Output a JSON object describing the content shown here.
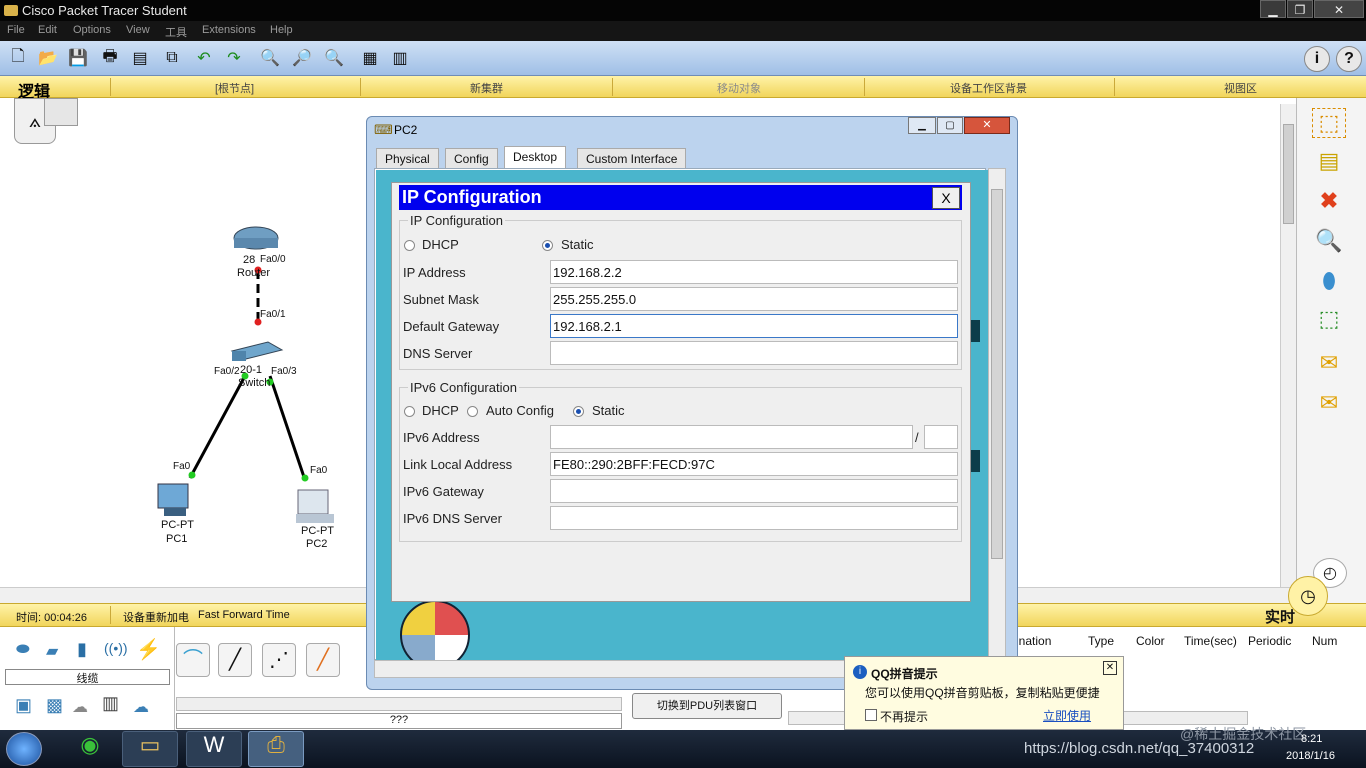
{
  "app": {
    "title": "Cisco Packet Tracer Student"
  },
  "menu": [
    "File",
    "Edit",
    "Options",
    "View",
    "工具",
    "Extensions",
    "Help"
  ],
  "nav": {
    "logic_tab": "逻辑",
    "segments": [
      "[根节点]",
      "新集群",
      "移动对象",
      "设备工作区背景",
      "视图区"
    ]
  },
  "topology": {
    "router": {
      "model": "28",
      "name": "Router",
      "port_top": "Fa0/0",
      "port_bottom": "Fa0/1"
    },
    "switch": {
      "model": "20-1",
      "name": "Switch",
      "port_left": "Fa0/2",
      "port_right": "Fa0/3"
    },
    "pc1": {
      "port": "Fa0",
      "type": "PC-PT",
      "name": "PC1"
    },
    "pc2": {
      "port": "Fa0",
      "type": "PC-PT",
      "name": "PC2"
    }
  },
  "dialog": {
    "title": "PC2",
    "tabs": [
      "Physical",
      "Config",
      "Desktop",
      "Custom Interface"
    ],
    "active_tab": "Desktop",
    "ip_window_title": "IP Configuration",
    "close_label": "X",
    "ipv4": {
      "group_label": "IP Configuration",
      "dhcp_label": "DHCP",
      "static_label": "Static",
      "mode": "Static",
      "ip_label": "IP Address",
      "ip": "192.168.2.2",
      "mask_label": "Subnet Mask",
      "mask": "255.255.255.0",
      "gw_label": "Default Gateway",
      "gw": "192.168.2.1",
      "dns_label": "DNS Server",
      "dns": ""
    },
    "ipv6": {
      "group_label": "IPv6 Configuration",
      "dhcp_label": "DHCP",
      "auto_label": "Auto Config",
      "static_label": "Static",
      "mode": "Static",
      "addr_label": "IPv6 Address",
      "addr": "",
      "prefix_sep": "/",
      "prefix": "",
      "link_label": "Link Local Address",
      "link": "FE80::290:2BFF:FECD:97C",
      "gw_label": "IPv6 Gateway",
      "gw": "",
      "dns_label": "IPv6 DNS Server",
      "dns": ""
    }
  },
  "status": {
    "time": "时间: 00:04:26",
    "power_cycle": "设备重新加电",
    "fast_forward": "Fast Forward Time",
    "realtime": "实时"
  },
  "bottom": {
    "device_category": "线缆",
    "unknown": "???",
    "pdu_button": "切换到PDU列表窗口",
    "pdu_columns": [
      "ination",
      "Type",
      "Color",
      "Time(sec)",
      "Periodic",
      "Num"
    ]
  },
  "popup": {
    "title": "QQ拼音提示",
    "message": "您可以使用QQ拼音剪贴板，复制粘贴更便捷",
    "checkbox": "不再提示",
    "link": "立即使用"
  },
  "taskbar": {
    "time": "8:21",
    "date": "2018/1/16",
    "watermark": "https://blog.csdn.net/qq_37400312",
    "watermark2": "@稀土掘金技术社区"
  },
  "colors": {
    "accent_blue": "#0000ee",
    "desktop_bg": "#4ab5cc",
    "nav_yellow": "#f1d55c",
    "link_green": "#22cc22"
  }
}
